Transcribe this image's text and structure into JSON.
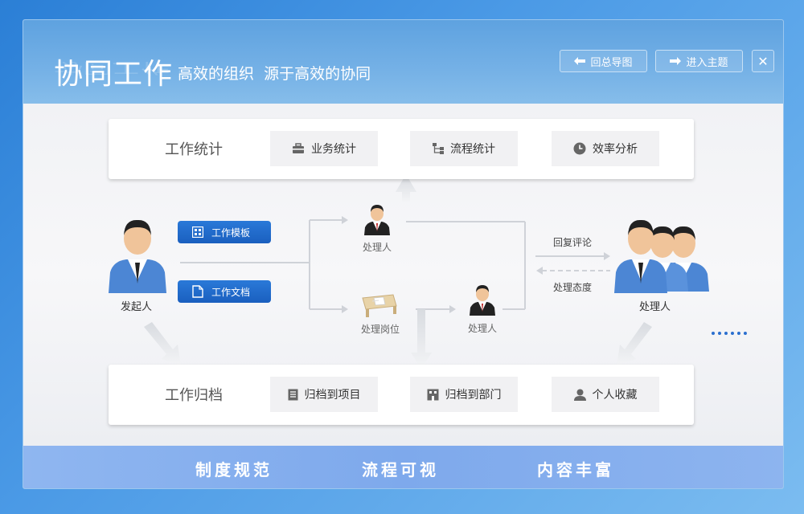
{
  "header": {
    "title": "协同工作",
    "subtitle": "高效的组织  源于高效的协同",
    "btn_back": "回总导图",
    "btn_enter": "进入主题",
    "close_glyph": "✕"
  },
  "stats_card": {
    "title": "工作统计",
    "buttons": [
      {
        "label": "业务统计",
        "icon": "briefcase-icon"
      },
      {
        "label": "流程统计",
        "icon": "flow-icon"
      },
      {
        "label": "效率分析",
        "icon": "clock-icon"
      }
    ]
  },
  "archive_card": {
    "title": "工作归档",
    "buttons": [
      {
        "label": "归档到项目",
        "icon": "document-icon"
      },
      {
        "label": "归档到部门",
        "icon": "building-icon"
      },
      {
        "label": "个人收藏",
        "icon": "user-icon"
      }
    ]
  },
  "flow": {
    "initiator": "发起人",
    "template_btn": "工作模板",
    "document_btn": "工作文档",
    "handler_top": "处理人",
    "post": "处理岗位",
    "handler_mid": "处理人",
    "reply": "回复评论",
    "attitude": "处理态度",
    "handlers_group": "处理人"
  },
  "footer": {
    "item1": "制度规范",
    "item2": "流程可视",
    "item3": "内容丰富"
  },
  "colors": {
    "accent": "#1a5fbf",
    "header": "#6eabe4"
  }
}
